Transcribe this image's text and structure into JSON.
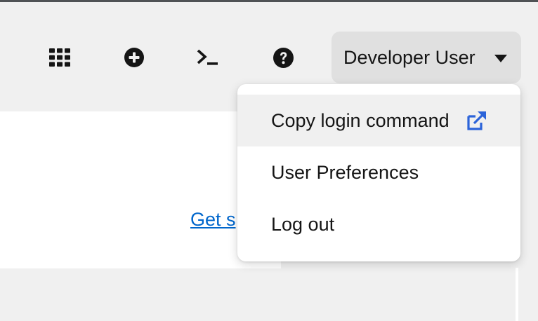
{
  "masthead": {
    "toolbar": [
      {
        "name": "application-launcher",
        "icon": "grid-icon"
      },
      {
        "name": "import-yaml",
        "icon": "plus-circle-icon"
      },
      {
        "name": "web-terminal",
        "icon": "terminal-icon"
      },
      {
        "name": "help",
        "icon": "question-circle-icon"
      }
    ],
    "user_menu": {
      "label": "Developer User",
      "icon": "caret-down-icon"
    }
  },
  "dropdown": {
    "items": [
      {
        "label": "Copy login command",
        "icon": "external-link-icon",
        "hovered": true
      },
      {
        "label": "User Preferences"
      },
      {
        "label": "Log out"
      }
    ]
  },
  "content": {
    "link_text": "Get s"
  },
  "colors": {
    "background": "#f0f0f0",
    "toggle_bg": "#e0e0e0",
    "menu_bg": "#ffffff",
    "link": "#0066cc",
    "icon_blue": "#2b63d9",
    "text": "#151515",
    "top_border": "#4f5255"
  }
}
